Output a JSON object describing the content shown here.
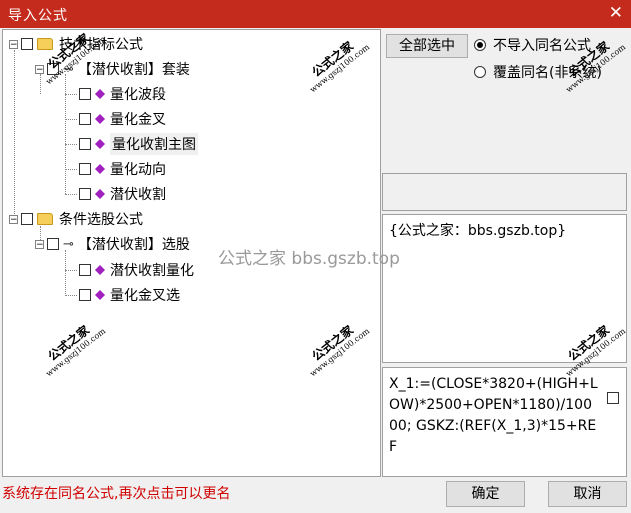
{
  "window": {
    "title": "导入公式",
    "close_glyph": "✕"
  },
  "tree": {
    "nodes": [
      {
        "label": "技术指标公式",
        "type": "folder"
      },
      {
        "label": "【潜伏收割】套装",
        "type": "key"
      },
      {
        "label": "量化波段",
        "type": "formula"
      },
      {
        "label": "量化金叉",
        "type": "formula"
      },
      {
        "label": "量化收割主图",
        "type": "formula",
        "selected": true
      },
      {
        "label": "量化动向",
        "type": "formula"
      },
      {
        "label": "潜伏收割",
        "type": "formula"
      },
      {
        "label": "条件选股公式",
        "type": "folder"
      },
      {
        "label": "【潜伏收割】选股",
        "type": "key"
      },
      {
        "label": "潜伏收割量化",
        "type": "formula"
      },
      {
        "label": "量化金叉选",
        "type": "formula"
      }
    ]
  },
  "buttons": {
    "select_all": "全部选中",
    "ok": "确定",
    "cancel": "取消"
  },
  "radios": [
    {
      "label": "不导入同名公式",
      "checked": true
    },
    {
      "label": "覆盖同名(非系统)",
      "checked": false
    }
  ],
  "info_text": "{公式之家：bbs.gszb.top}",
  "code_text": "X_1:=(CLOSE*3820+(HIGH+LOW)*2500+OPEN*1180)/10000;\nGSKZ:(REF(X_1,3)*15+REF",
  "status_text": "系统存在同名公式,再次点击可以更名",
  "watermark": {
    "main": "公式之家",
    "url": "www.gszj100.com",
    "center": "公式之家 bbs.gszb.top"
  },
  "colors": {
    "titlebar": "#c42b1c",
    "status": "#d00000",
    "folder": "#f5cf59",
    "gem": "#a020c0"
  }
}
